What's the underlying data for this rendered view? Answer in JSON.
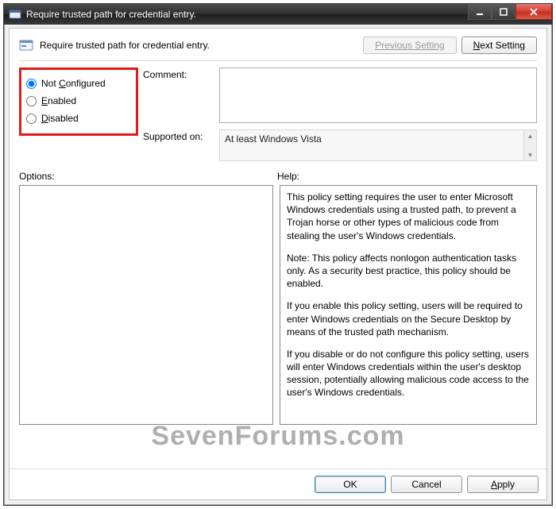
{
  "window": {
    "title": "Require trusted path for credential entry."
  },
  "header": {
    "heading": "Require trusted path for credential entry.",
    "previous_label": "Previous Setting",
    "next_label_pre": "N",
    "next_label_post": "ext Setting"
  },
  "state_options": {
    "not_configured": {
      "pre": "Not ",
      "u": "C",
      "post": "onfigured"
    },
    "enabled": {
      "pre": "",
      "u": "E",
      "post": "nabled"
    },
    "disabled": {
      "pre": "",
      "u": "D",
      "post": "isabled"
    },
    "selected": "not_configured"
  },
  "labels": {
    "comment": "Comment:",
    "supported_on": "Supported on:",
    "options": "Options:",
    "help": "Help:"
  },
  "fields": {
    "comment_value": "",
    "supported_value": "At least Windows Vista"
  },
  "help": {
    "p1": "This policy setting requires the user to enter Microsoft Windows credentials using a trusted path, to prevent a Trojan horse or other types of malicious code from stealing the user's Windows credentials.",
    "p2": "Note: This policy affects nonlogon authentication tasks only. As a security best practice, this policy should be enabled.",
    "p3": "If you enable this policy setting, users will be required to enter Windows credentials on the Secure Desktop by means of the trusted path mechanism.",
    "p4": "If you disable or do not configure this policy setting, users will enter Windows credentials within the user's desktop session, potentially allowing malicious code access to the user's Windows credentials."
  },
  "buttons": {
    "ok": "OK",
    "cancel": "Cancel",
    "apply_u": "A",
    "apply_post": "pply"
  },
  "watermark": "SevenForums.com"
}
